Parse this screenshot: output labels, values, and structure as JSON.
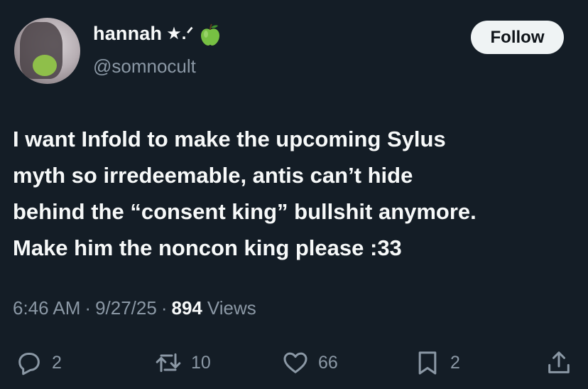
{
  "author": {
    "display_name": "hannah",
    "name_decoration": "★.ᐟ",
    "emoji_icon": "green-apple-icon",
    "handle": "@somnocult"
  },
  "follow_button": {
    "label": "Follow"
  },
  "tweet": {
    "lines": [
      "I want Infold to make the upcoming Sylus",
      "myth so irredeemable, antis can’t hide",
      "behind the “consent king” bullshit anymore.",
      "Make him the noncon king please :33"
    ]
  },
  "meta": {
    "time": "6:46 AM",
    "separator": "·",
    "date": "9/27/25",
    "views_count": "894",
    "views_label": "Views"
  },
  "actions": {
    "replies": "2",
    "reposts": "10",
    "likes": "66",
    "bookmarks": "2"
  },
  "colors": {
    "background": "#141d26",
    "text_primary": "#f7f9f9",
    "text_secondary": "#8b98a5",
    "button_bg": "#eff3f4"
  }
}
